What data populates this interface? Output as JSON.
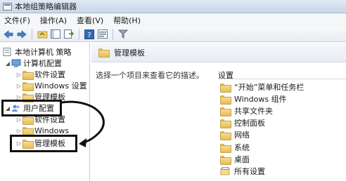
{
  "window": {
    "title": "本地组策略编辑器"
  },
  "menu": [
    "文件(F)",
    "操作(A)",
    "查看(V)",
    "帮助(H)"
  ],
  "toolbar": {
    "icons": [
      "back-arrow-icon",
      "forward-arrow-icon",
      "up-folder-icon",
      "show-hide-tree-icon",
      "export-list-icon",
      "help-icon",
      "properties-icon",
      "filter-icon"
    ]
  },
  "tree": {
    "root": "本地计算机 策略",
    "computer_config": "计算机配置",
    "computer_children": [
      "软件设置",
      "Windows 设置",
      "管理模板"
    ],
    "user_config": "用户配置",
    "user_children": [
      "软件设置",
      "Windows",
      "管理模板"
    ]
  },
  "content": {
    "header": "管理模板",
    "description": "选择一个项目来查看它的描述。",
    "column_header": "设置",
    "items": [
      "“开始”菜单和任务栏",
      "Windows 组件",
      "共享文件夹",
      "控制面板",
      "网络",
      "系统",
      "桌面",
      "所有设置"
    ]
  },
  "annotation": {
    "highlight_color": "#111111"
  }
}
